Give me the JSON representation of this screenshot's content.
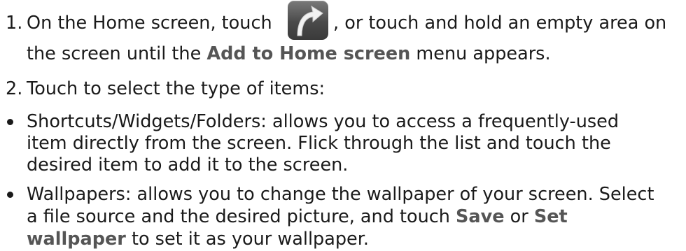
{
  "step1": {
    "number": "1.",
    "line1_before_icon": "On the Home screen, touch",
    "line1_after_icon": ", or touch and hold an empty area on",
    "line2_before": "the screen until the ",
    "line2_highlight": "Add to Home screen",
    "line2_after": " menu appears.",
    "icon": "curved-arrow-icon"
  },
  "step2": {
    "number": "2.",
    "text": "Touch to select the type of items:"
  },
  "bullet1": {
    "line1": "Shortcuts/Widgets/Folders: allows you to access a frequently-used",
    "line2": "item directly from the screen. Flick through the list and touch the",
    "line3": "desired item to add it to the screen."
  },
  "bullet2": {
    "line1": "Wallpapers: allows you to change the wallpaper of your screen. Select",
    "line2_before": "a file source and the desired picture, and touch ",
    "line2_save": "Save",
    "line2_or": " or ",
    "line2_set": "Set",
    "line3_wallpaper": "wallpaper",
    "line3_after": " to set it as your wallpaper."
  }
}
